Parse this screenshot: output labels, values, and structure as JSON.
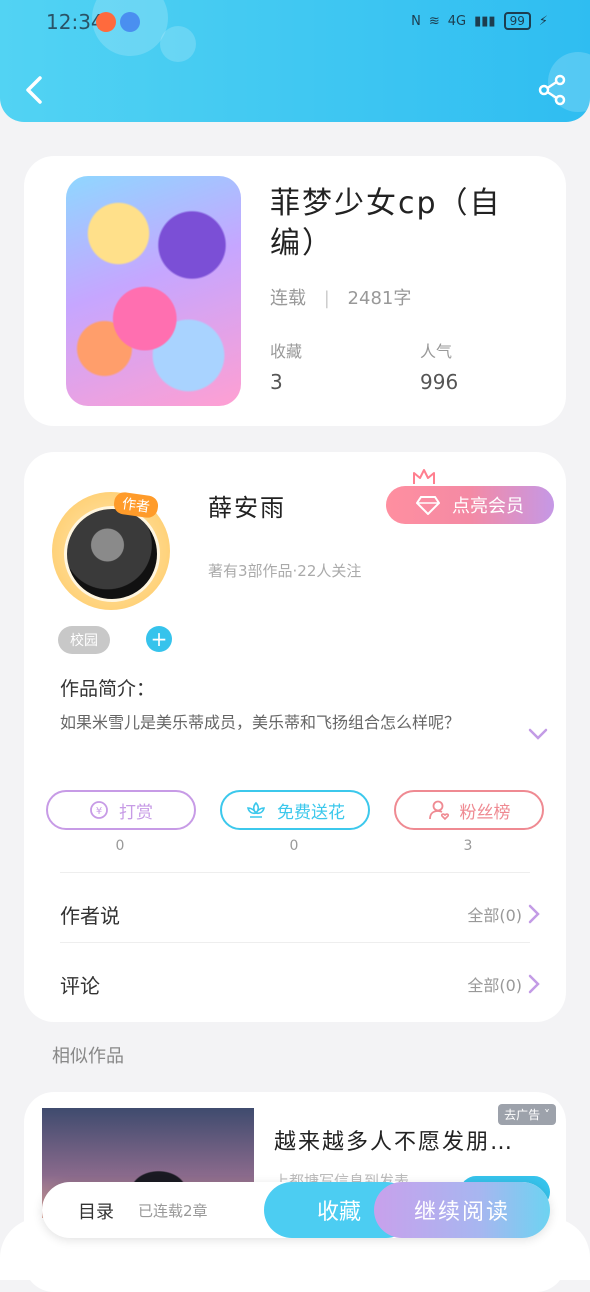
{
  "status_bar": {
    "time": "12:34",
    "network": "4G",
    "battery": "99"
  },
  "book": {
    "title": "菲梦少女cp（自编）",
    "status": "连载",
    "separator": "|",
    "word_count": "2481字",
    "stats": [
      {
        "label": "收藏",
        "value": "3"
      },
      {
        "label": "人气",
        "value": "996"
      }
    ]
  },
  "author": {
    "badge": "作者",
    "name": "薛安雨",
    "summary": "著有3部作品·22人关注",
    "vip_label": "点亮会员",
    "tag": "校园",
    "plus": "+",
    "intro_label": "作品简介：",
    "intro_text": "如果米雪儿是美乐蒂成员，美乐蒂和飞扬组合怎么样呢？"
  },
  "actions": [
    {
      "label": "打赏",
      "count": "0",
      "color": "#c79be6"
    },
    {
      "label": "免费送花",
      "count": "0",
      "color": "#3cc8ec"
    },
    {
      "label": "粉丝榜",
      "count": "3",
      "color": "#ef8a92"
    }
  ],
  "rows": [
    {
      "label": "作者说",
      "right": "全部(0)"
    },
    {
      "label": "评论",
      "right": "全部(0)"
    }
  ],
  "similar": {
    "heading": "相似作品",
    "item_title": "越来越多人不愿发朋…",
    "item_sub": "上都塘写信息到发表",
    "ad_label": "去广告"
  },
  "bottom_bar": {
    "toc": "目录",
    "progress": "已连载2章",
    "favorite": "收藏",
    "continue": "继续阅读"
  },
  "colors": {
    "header": "#2fbdf1",
    "accent": "#36c3ec",
    "vip_start": "#ff8fa0",
    "vip_end": "#c598e6"
  },
  "icons": {
    "back": "back-arrow-icon",
    "share": "share-icon",
    "expand": "chevron-down-icon",
    "row_arrow": "chevron-right-icon"
  }
}
